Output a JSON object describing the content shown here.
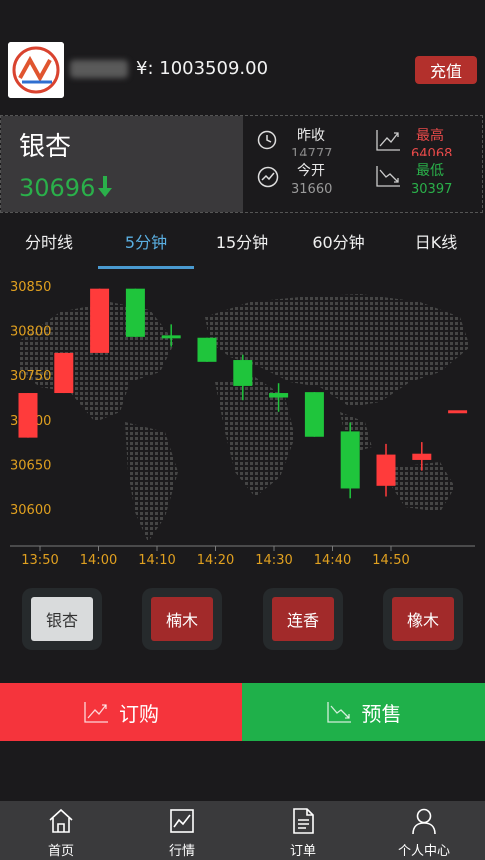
{
  "header": {
    "balance": "¥: 1003509.00",
    "recharge_label": "充值"
  },
  "product": {
    "name": "银杏",
    "price": "30696",
    "trend": "down"
  },
  "stats": {
    "prev_close_label": "昨收",
    "prev_close_value": "14777",
    "open_label": "今开",
    "open_value": "31660",
    "high_label": "最高",
    "high_value": "64068",
    "low_label": "最低",
    "low_value": "30397"
  },
  "tabs": [
    {
      "label": "分时线",
      "active": false
    },
    {
      "label": "5分钟",
      "active": true
    },
    {
      "label": "15分钟",
      "active": false
    },
    {
      "label": "60分钟",
      "active": false
    },
    {
      "label": "日K线",
      "active": false
    }
  ],
  "chart_data": {
    "type": "candlestick",
    "y_ticks": [
      "30850",
      "30800",
      "30750",
      "30700",
      "30650",
      "30600"
    ],
    "ylim": [
      30600,
      30850
    ],
    "x_ticks": [
      "13:50",
      "14:00",
      "14:10",
      "14:20",
      "14:30",
      "14:40",
      "14:50"
    ],
    "up_color": "#ff3b3b",
    "down_color": "#1fc53c",
    "candles": [
      {
        "open": 30680,
        "close": 30730,
        "high": 30730,
        "low": 30680
      },
      {
        "open": 30730,
        "close": 30775,
        "high": 30775,
        "low": 30730
      },
      {
        "open": 30775,
        "close": 30847,
        "high": 30847,
        "low": 30775
      },
      {
        "open": 30847,
        "close": 30793,
        "high": 30847,
        "low": 30793
      },
      {
        "open": 30793,
        "close": 30790,
        "high": 30807,
        "low": 30782
      },
      {
        "open": 30792,
        "close": 30765,
        "high": 30792,
        "low": 30765
      },
      {
        "open": 30767,
        "close": 30738,
        "high": 30773,
        "low": 30722
      },
      {
        "open": 30730,
        "close": 30725,
        "high": 30741,
        "low": 30709
      },
      {
        "open": 30731,
        "close": 30681,
        "high": 30731,
        "low": 30681
      },
      {
        "open": 30687,
        "close": 30623,
        "high": 30697,
        "low": 30612
      },
      {
        "open": 30626,
        "close": 30661,
        "high": 30673,
        "low": 30614
      },
      {
        "open": 30655,
        "close": 30662,
        "high": 30675,
        "low": 30643
      },
      {
        "open": 30709,
        "close": 30709,
        "high": 30709,
        "low": 30709
      }
    ]
  },
  "product_buttons": [
    {
      "label": "银杏",
      "selected": true
    },
    {
      "label": "楠木",
      "selected": false
    },
    {
      "label": "连香",
      "selected": false
    },
    {
      "label": "橡木",
      "selected": false
    }
  ],
  "actions": {
    "buy_label": "订购",
    "buy_color": "#f5343c",
    "presale_label": "预售",
    "presale_color": "#1fb04a"
  },
  "nav": [
    {
      "label": "首页",
      "icon": "home-icon"
    },
    {
      "label": "行情",
      "icon": "chart-icon"
    },
    {
      "label": "订单",
      "icon": "document-icon"
    },
    {
      "label": "个人中心",
      "icon": "user-icon"
    }
  ]
}
